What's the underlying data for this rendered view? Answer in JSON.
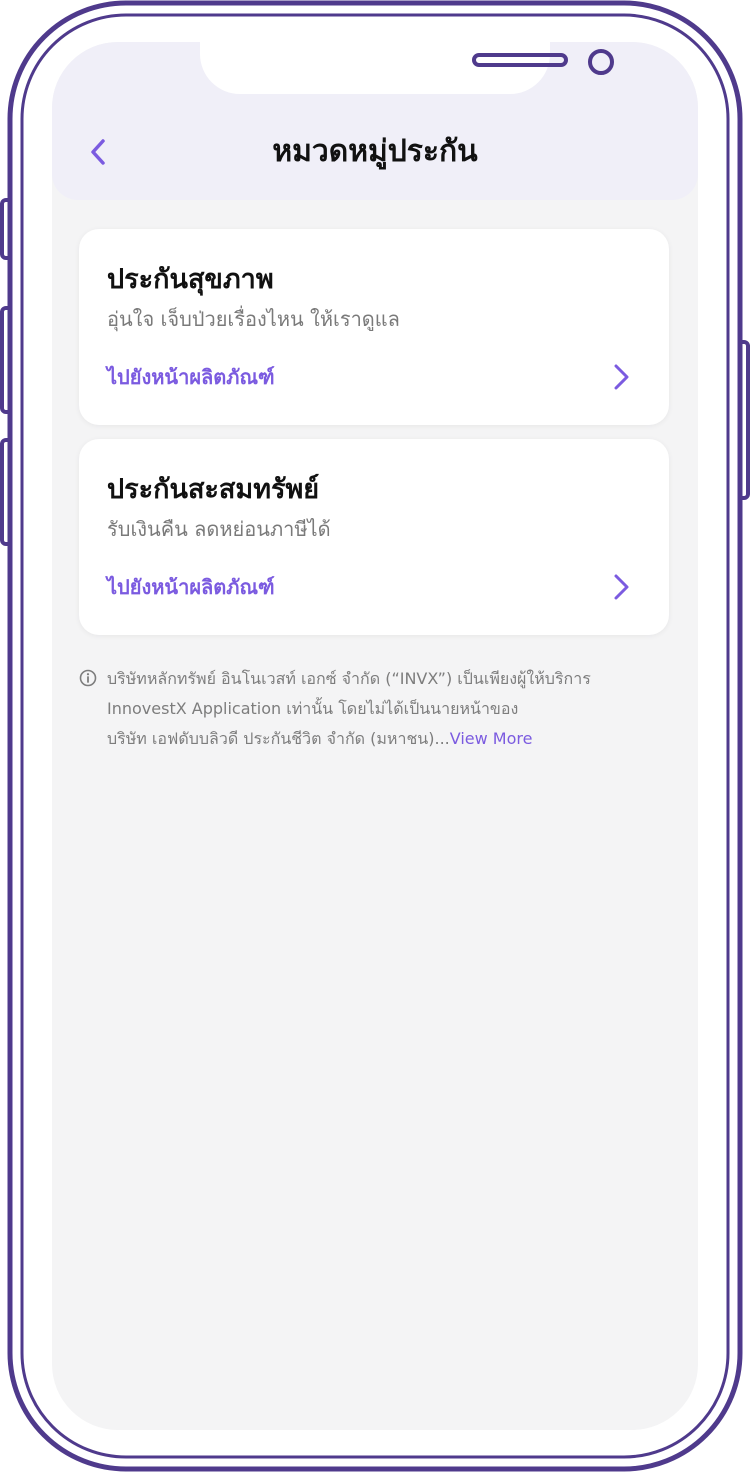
{
  "header": {
    "title": "หมวดหมู่ประกัน",
    "back_icon": "chevron-left-icon"
  },
  "cards": [
    {
      "title": "ประกันสุขภาพ",
      "subtitle": "อุ่นใจ เจ็บป่วยเรื่องไหน ให้เราดูแล",
      "link": "ไปยังหน้าผลิตภัณฑ์",
      "icon": "chevron-right-icon"
    },
    {
      "title": "ประกันสะสมทรัพย์",
      "subtitle": "รับเงินคืน ลดหย่อนภาษีได้",
      "link": "ไปยังหน้าผลิตภัณฑ์",
      "icon": "chevron-right-icon"
    }
  ],
  "disclaimer": {
    "icon": "info-icon",
    "line1": "บริษัทหลักทรัพย์ อินโนเวสท์ เอกซ์ จำกัด (“INVX”) เป็นเพียงผู้ให้บริการ",
    "line2": "InnovestX Application เท่านั้น โดยไม่ได้เป็นนายหน้าของ",
    "line3": "บริษัท เอฟดับบลิวดี ประกันชีวิต จำกัด (มหาชน)...",
    "view_more": "View More"
  },
  "colors": {
    "accent": "#7b5be0",
    "frame": "#4f3a8c",
    "header_bg": "#f0eff8",
    "screen_bg": "#f4f4f5"
  }
}
